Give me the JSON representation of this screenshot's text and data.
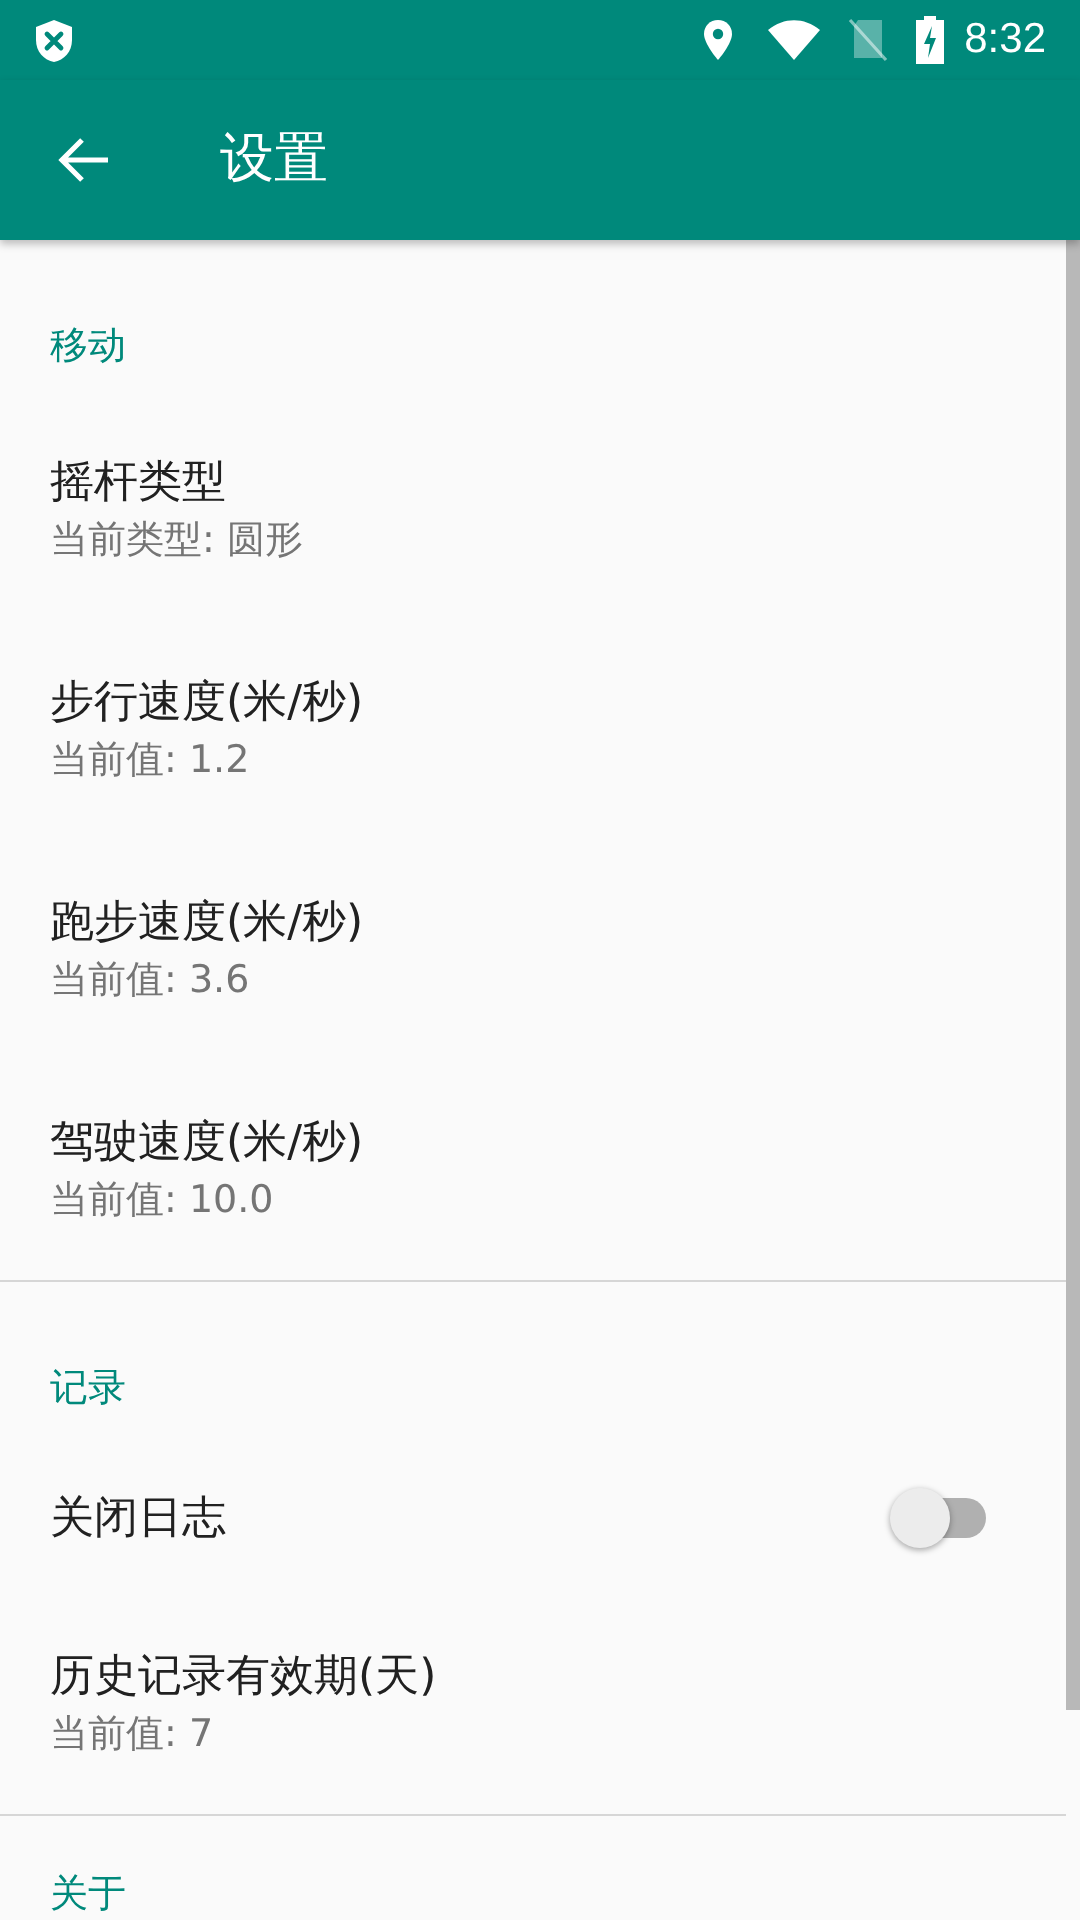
{
  "status_bar": {
    "time": "8:32"
  },
  "app_bar": {
    "title": "设置"
  },
  "sections": [
    {
      "title": "移动",
      "items": [
        {
          "kind": "text",
          "title": "摇杆类型",
          "summary": "当前类型: 圆形"
        },
        {
          "kind": "text",
          "title": "步行速度(米/秒)",
          "summary": "当前值: 1.2"
        },
        {
          "kind": "text",
          "title": "跑步速度(米/秒)",
          "summary": "当前值: 3.6"
        },
        {
          "kind": "text",
          "title": "驾驶速度(米/秒)",
          "summary": "当前值: 10.0"
        }
      ]
    },
    {
      "title": "记录",
      "items": [
        {
          "kind": "switch",
          "title": "关闭日志",
          "on": false
        },
        {
          "kind": "text",
          "title": "历史记录有效期(天)",
          "summary": "当前值: 7"
        }
      ]
    },
    {
      "title": "关于"
    }
  ]
}
